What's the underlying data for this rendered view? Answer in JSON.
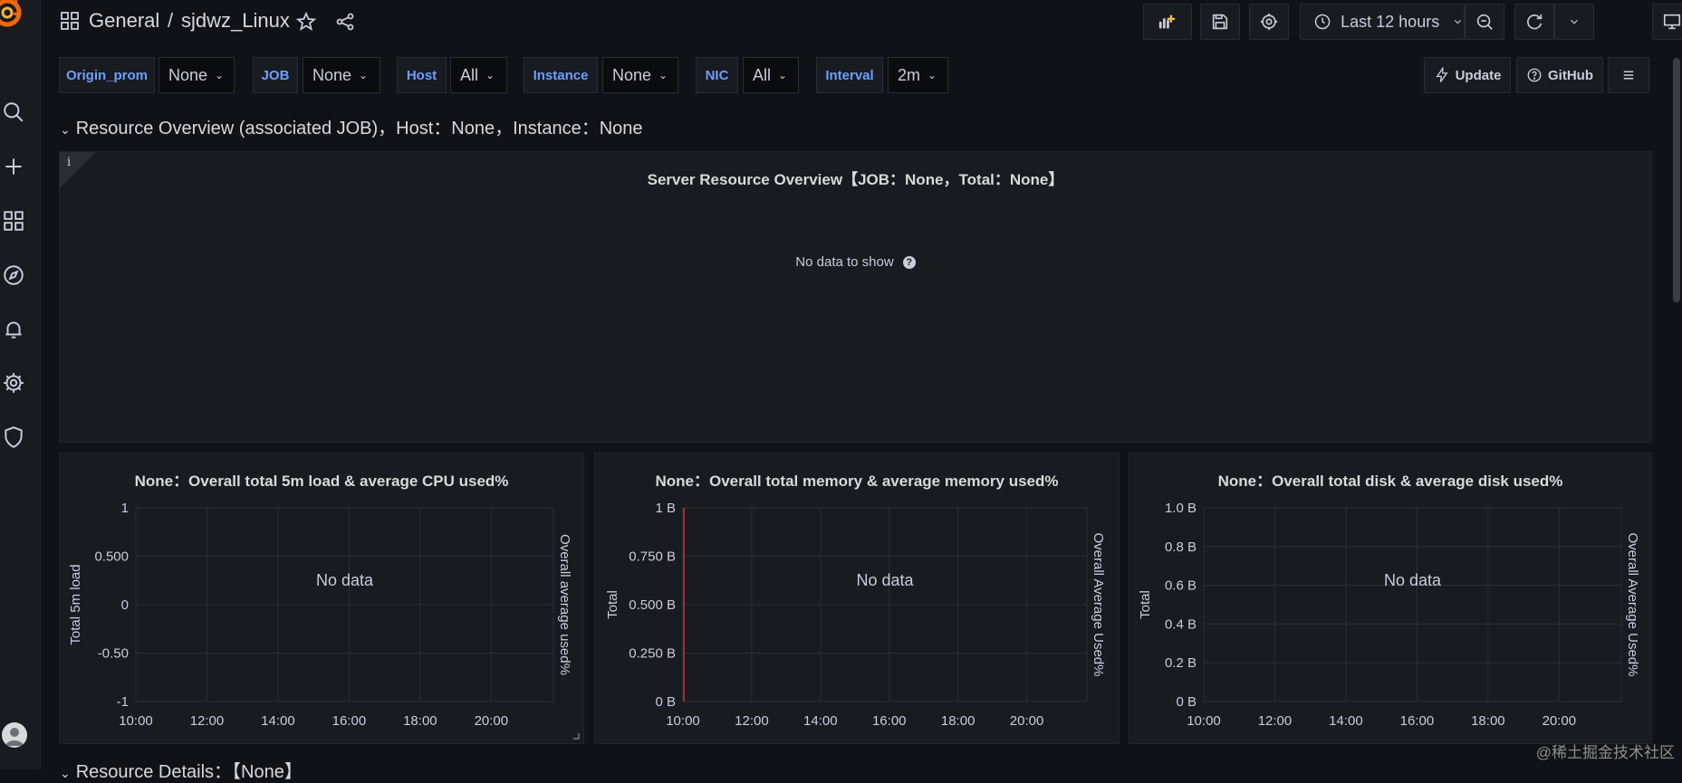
{
  "breadcrumb": {
    "folder": "General",
    "separator": "/",
    "title": "sjdwz_Linux"
  },
  "time_picker": {
    "label": "Last 12 hours"
  },
  "variables": [
    {
      "label": "Origin_prom",
      "value": "None"
    },
    {
      "label": "JOB",
      "value": "None"
    },
    {
      "label": "Host",
      "value": "All"
    },
    {
      "label": "Instance",
      "value": "None"
    },
    {
      "label": "NIC",
      "value": "All"
    },
    {
      "label": "Interval",
      "value": "2m"
    }
  ],
  "links": {
    "update": "Update",
    "github": "GitHub"
  },
  "rows": {
    "overview": "Resource Overview (associated JOB)，Host：None，Instance：None",
    "details": "Resource Details：【None】"
  },
  "overview_panel": {
    "info": "i",
    "title": "Server Resource Overview【JOB：None，Total：None】",
    "message": "No data to show",
    "help": "?"
  },
  "no_data_text": "No data",
  "watermark": "@稀土掘金技术社区",
  "colors": {
    "accent": "#6e9fff",
    "background": "#111217",
    "panel": "#181b1f",
    "annotation": "#e02f44"
  },
  "chart_data": [
    {
      "type": "line",
      "title": "None：Overall total 5m load & average CPU used%",
      "x_ticks": [
        "10:00",
        "12:00",
        "14:00",
        "16:00",
        "18:00",
        "20:00"
      ],
      "y_ticks": [
        "1",
        "0.500",
        "0",
        "-0.50",
        "-1"
      ],
      "ylim": [
        -1,
        1
      ],
      "ylabel": "Total 5m load",
      "y2label": "Overall average used%",
      "series": [],
      "grid": true,
      "has_annotation": false
    },
    {
      "type": "line",
      "title": "None：Overall total memory & average memory used%",
      "x_ticks": [
        "10:00",
        "12:00",
        "14:00",
        "16:00",
        "18:00",
        "20:00"
      ],
      "y_ticks": [
        "1 B",
        "0.750 B",
        "0.500 B",
        "0.250 B",
        "0 B"
      ],
      "ylim": [
        0,
        1
      ],
      "ylabel": "Total",
      "y2label": "Overall Average Used%",
      "series": [],
      "grid": true,
      "has_annotation": true
    },
    {
      "type": "line",
      "title": "None：Overall total disk & average disk used%",
      "x_ticks": [
        "10:00",
        "12:00",
        "14:00",
        "16:00",
        "18:00",
        "20:00"
      ],
      "y_ticks": [
        "1.0 B",
        "0.8 B",
        "0.6 B",
        "0.4 B",
        "0.2 B",
        "0 B"
      ],
      "ylim": [
        0,
        1
      ],
      "ylabel": "Total",
      "y2label": "Overall Average Used%",
      "series": [],
      "grid": true,
      "has_annotation": false
    }
  ]
}
